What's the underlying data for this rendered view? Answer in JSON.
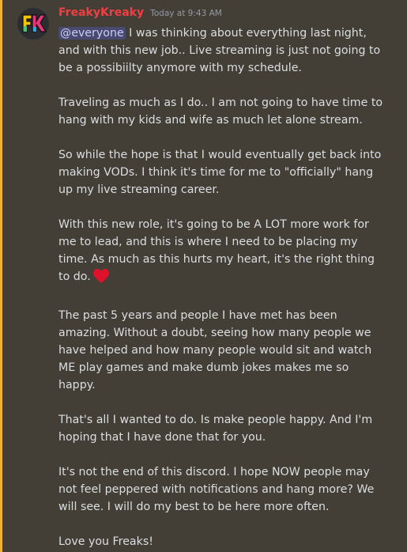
{
  "message": {
    "author": "FreakyKreaky",
    "timestamp": "Today at 9:43 AM",
    "mention": "@everyone",
    "paragraph_1_rest": " I was thinking about everything last night, and with this new job.. Live streaming is just not going to be a possibiilty anymore with my schedule.",
    "paragraph_2": "Traveling as much as I do.. I am not going to have time to hang with my kids and wife as much let alone stream.",
    "paragraph_3": "So while the hope is that I would eventually get back into making VODs. I think it's time for me to \"officially\" hang up my live streaming career.",
    "paragraph_4": "With this new role, it's going to be A LOT more work for me to lead, and this is where I need to be placing my time. As much as this hurts my heart, it's the right thing to do.",
    "paragraph_5": "The past 5 years and people I have met has been amazing. Without a doubt, seeing how many people we have helped and how many people would sit and watch ME play games and make dumb jokes makes me so happy.",
    "paragraph_6": "That's all I wanted to do. Is make people happy. And I'm hoping that I have done that for you.",
    "paragraph_7": "It's not the end of this discord. I hope NOW people may not feel peppered with notifications and hang more? We will see. I will do my best to be here more often.",
    "paragraph_8": "Love you Freaks!",
    "emoji": "red-heart-emoji"
  },
  "colors": {
    "highlight_background": "#433f37",
    "mention_bar": "#f0b232",
    "username": "#f23f42",
    "text": "#dbdee1",
    "timestamp": "#949ba4",
    "heart": "#e0112b"
  }
}
